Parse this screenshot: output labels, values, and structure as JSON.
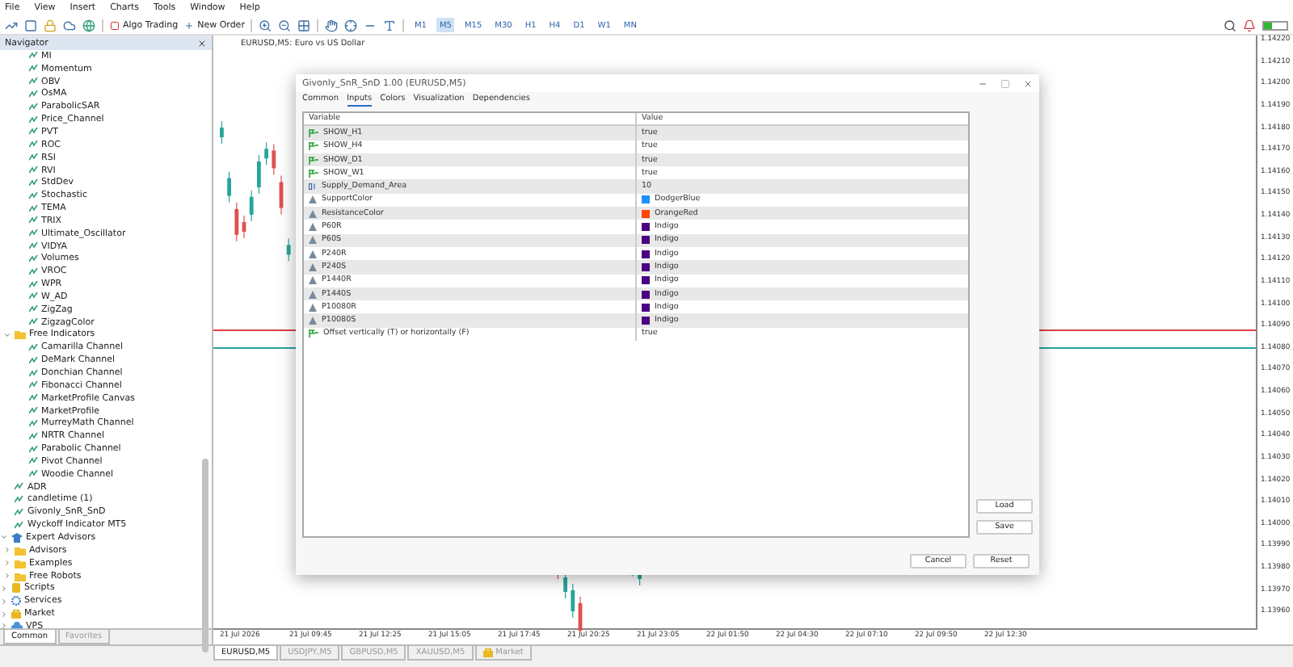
{
  "menu": [
    "File",
    "View",
    "Insert",
    "Charts",
    "Tools",
    "Window",
    "Help"
  ],
  "toolbar": {
    "algo_trading": "Algo Trading",
    "new_order": "New Order",
    "timeframes": [
      {
        "label": "M1",
        "selected": false
      },
      {
        "label": "M5",
        "selected": true
      },
      {
        "label": "M15",
        "selected": false
      },
      {
        "label": "M30",
        "selected": false
      },
      {
        "label": "H1",
        "selected": false
      },
      {
        "label": "H4",
        "selected": false
      },
      {
        "label": "D1",
        "selected": false
      },
      {
        "label": "W1",
        "selected": false
      },
      {
        "label": "MN",
        "selected": false
      }
    ]
  },
  "navigator": {
    "title": "Navigator",
    "tree": [
      {
        "kind": "group",
        "children": [
          {
            "kind": "group",
            "children": [
              {
                "kind": "indicator",
                "label": "MI"
              },
              {
                "kind": "indicator",
                "label": "Momentum"
              },
              {
                "kind": "indicator",
                "label": "OBV"
              },
              {
                "kind": "indicator",
                "label": "OsMA"
              },
              {
                "kind": "indicator",
                "label": "ParabolicSAR"
              },
              {
                "kind": "indicator",
                "label": "Price_Channel"
              },
              {
                "kind": "indicator",
                "label": "PVT"
              },
              {
                "kind": "indicator",
                "label": "ROC"
              },
              {
                "kind": "indicator",
                "label": "RSI"
              },
              {
                "kind": "indicator",
                "label": "RVI"
              },
              {
                "kind": "indicator",
                "label": "StdDev"
              },
              {
                "kind": "indicator",
                "label": "Stochastic"
              },
              {
                "kind": "indicator",
                "label": "TEMA"
              },
              {
                "kind": "indicator",
                "label": "TRIX"
              },
              {
                "kind": "indicator",
                "label": "Ultimate_Oscillator"
              },
              {
                "kind": "indicator",
                "label": "VIDYA"
              },
              {
                "kind": "indicator",
                "label": "Volumes"
              },
              {
                "kind": "indicator",
                "label": "VROC"
              },
              {
                "kind": "indicator",
                "label": "WPR"
              },
              {
                "kind": "indicator",
                "label": "W_AD"
              },
              {
                "kind": "indicator",
                "label": "ZigZag"
              },
              {
                "kind": "indicator",
                "label": "ZigzagColor"
              }
            ]
          },
          {
            "kind": "folder",
            "label": "Free Indicators",
            "expanded": true,
            "children": [
              {
                "kind": "indicator",
                "label": "Camarilla Channel"
              },
              {
                "kind": "indicator",
                "label": "DeMark Channel"
              },
              {
                "kind": "indicator",
                "label": "Donchian Channel"
              },
              {
                "kind": "indicator",
                "label": "Fibonacci Channel"
              },
              {
                "kind": "indicator",
                "label": "MarketProfile Canvas"
              },
              {
                "kind": "indicator",
                "label": "MarketProfile"
              },
              {
                "kind": "indicator",
                "label": "MurreyMath Channel"
              },
              {
                "kind": "indicator",
                "label": "NRTR Channel"
              },
              {
                "kind": "indicator",
                "label": "Parabolic Channel"
              },
              {
                "kind": "indicator",
                "label": "Pivot Channel"
              },
              {
                "kind": "indicator",
                "label": "Woodie Channel"
              }
            ]
          },
          {
            "kind": "indicator",
            "label": "ADR"
          },
          {
            "kind": "indicator",
            "label": "candletime (1)"
          },
          {
            "kind": "indicator",
            "label": "Givonly_SnR_SnD"
          },
          {
            "kind": "indicator",
            "label": "Wyckoff Indicator MT5"
          }
        ]
      },
      {
        "kind": "experts",
        "label": "Expert Advisors",
        "expanded": true,
        "children": [
          {
            "kind": "folder",
            "label": "Advisors",
            "expanded": false
          },
          {
            "kind": "folder",
            "label": "Examples",
            "expanded": false
          },
          {
            "kind": "folder",
            "label": "Free Robots",
            "expanded": false
          }
        ]
      },
      {
        "kind": "scripts",
        "label": "Scripts",
        "expanded": false
      },
      {
        "kind": "services",
        "label": "Services",
        "expanded": false
      },
      {
        "kind": "market",
        "label": "Market",
        "expanded": false
      },
      {
        "kind": "vps",
        "label": "VPS",
        "expanded": false
      }
    ],
    "tabs": [
      {
        "label": "Common",
        "selected": true
      },
      {
        "label": "Favorites",
        "selected": false
      }
    ]
  },
  "chart": {
    "title": "EURUSD,M5: Euro vs US Dollar",
    "price_axis": [
      "1.14220",
      "1.14210",
      "1.14200",
      "1.14190",
      "1.14180",
      "1.14170",
      "1.14160",
      "1.14150",
      "1.14140",
      "1.14130",
      "1.14120",
      "1.14110",
      "1.14100",
      "1.14090",
      "1.14080",
      "1.14070",
      "1.14060",
      "1.14050",
      "1.14040",
      "1.14030",
      "1.14020",
      "1.14010",
      "1.14000",
      "1.13990",
      "1.13980",
      "1.13970",
      "1.13960"
    ],
    "time_axis": [
      "21 Jul 2026",
      "21 Jul 09:45",
      "21 Jul 12:25",
      "21 Jul 15:05",
      "21 Jul 17:45",
      "21 Jul 20:25",
      "21 Jul 23:05",
      "22 Jul 01:50",
      "22 Jul 04:30",
      "22 Jul 07:10",
      "22 Jul 09:50",
      "22 Jul 12:30"
    ]
  },
  "dialog": {
    "title": "Givonly_SnR_SnD 1.00 (EURUSD,M5)",
    "tabs": [
      {
        "label": "Common",
        "selected": false
      },
      {
        "label": "Inputs",
        "selected": true
      },
      {
        "label": "Colors",
        "selected": false
      },
      {
        "label": "Visualization",
        "selected": false
      },
      {
        "label": "Dependencies",
        "selected": false
      }
    ],
    "columns": [
      "Variable",
      "Value"
    ],
    "rows": [
      {
        "kind": "bool",
        "variable": "SHOW_H1",
        "value": "true"
      },
      {
        "kind": "bool",
        "variable": "SHOW_H4",
        "value": "true"
      },
      {
        "kind": "bool",
        "variable": "SHOW_D1",
        "value": "true"
      },
      {
        "kind": "bool",
        "variable": "SHOW_W1",
        "value": "true"
      },
      {
        "kind": "int",
        "variable": "Supply_Demand_Area",
        "value": "10"
      },
      {
        "kind": "color",
        "variable": "SupportColor",
        "value": "DodgerBlue",
        "color": "#1e90ff"
      },
      {
        "kind": "color",
        "variable": "ResistanceColor",
        "value": "OrangeRed",
        "color": "#ff4500"
      },
      {
        "kind": "color",
        "variable": "P60R",
        "value": "Indigo",
        "color": "#4b0082"
      },
      {
        "kind": "color",
        "variable": "P60S",
        "value": "Indigo",
        "color": "#4b0082"
      },
      {
        "kind": "color",
        "variable": "P240R",
        "value": "Indigo",
        "color": "#4b0082"
      },
      {
        "kind": "color",
        "variable": "P240S",
        "value": "Indigo",
        "color": "#4b0082"
      },
      {
        "kind": "color",
        "variable": "P1440R",
        "value": "Indigo",
        "color": "#4b0082"
      },
      {
        "kind": "color",
        "variable": "P1440S",
        "value": "Indigo",
        "color": "#4b0082"
      },
      {
        "kind": "color",
        "variable": "P10080R",
        "value": "Indigo",
        "color": "#4b0082"
      },
      {
        "kind": "color",
        "variable": "P10080S",
        "value": "Indigo",
        "color": "#4b0082"
      },
      {
        "kind": "bool",
        "variable": "Offset vertically (T) or horizontally (F)",
        "value": "true"
      }
    ],
    "side_buttons": [
      "Load",
      "Save"
    ],
    "buttons": [
      "Cancel",
      "Reset"
    ]
  },
  "symbol_tabs": [
    {
      "kind": "chart",
      "label": "EURUSD,M5",
      "selected": true
    },
    {
      "kind": "chart",
      "label": "USDJPY,M5",
      "selected": false
    },
    {
      "kind": "chart",
      "label": "GBPUSD,M5",
      "selected": false
    },
    {
      "kind": "chart",
      "label": "XAUUSD,M5",
      "selected": false
    },
    {
      "kind": "market",
      "label": "Market",
      "selected": false
    }
  ]
}
